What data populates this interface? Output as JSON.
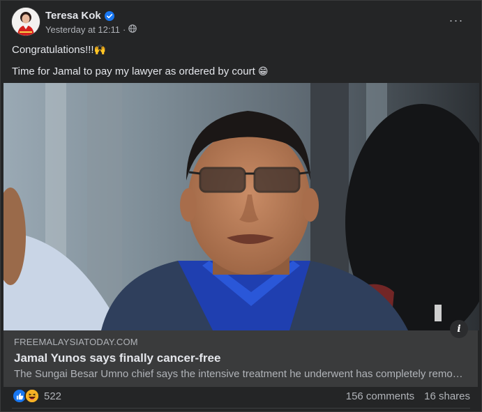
{
  "post": {
    "author": "Teresa Kok",
    "timestamp": "Yesterday at 12:11",
    "separator": "·",
    "privacy_icon": "globe-icon",
    "more_label": "···",
    "text_lines": [
      "Congratulations!!!",
      "Time for Jamal to pay my lawyer as ordered by court"
    ],
    "emojis": [
      "🙌",
      "😁"
    ]
  },
  "link": {
    "domain": "FREEMALAYSIATODAY.COM",
    "title": "Jamal Yunos says finally cancer-free",
    "description": "The Sungai Besar Umno chief says the intensive treatment he underwent has completely removed the cancer cells from his body.",
    "info_label": "i"
  },
  "stats": {
    "reactions_count": "522",
    "comments": "156 comments",
    "shares": "16 shares",
    "reaction_types": [
      "like-icon",
      "haha-icon"
    ]
  },
  "colors": {
    "background": "#242526",
    "text_primary": "#e4e6eb",
    "text_secondary": "#b0b3b8",
    "link_card": "#3a3b3c",
    "verified": "#1877f2"
  }
}
